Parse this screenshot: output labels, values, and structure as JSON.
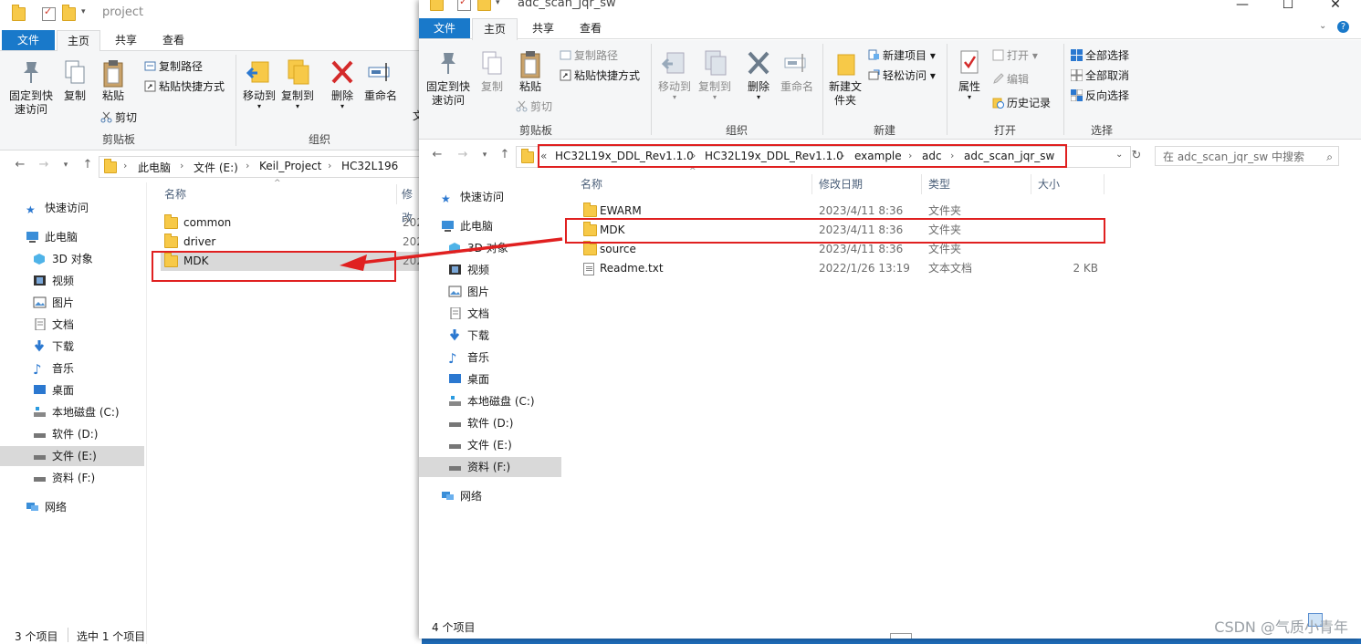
{
  "left": {
    "title": "project",
    "tabs": [
      "文件",
      "主页",
      "共享",
      "查看"
    ],
    "ribbon": {
      "pin": "固定到快速访问",
      "copy": "复制",
      "paste": "粘贴",
      "copy_path": "复制路径",
      "paste_shortcut": "粘贴快捷方式",
      "cut": "剪切",
      "clipboard": "剪贴板",
      "move_to": "移动到",
      "copy_to": "复制到",
      "delete": "删除",
      "rename": "重命名",
      "new_partial": "文",
      "organize": "组织"
    },
    "breadcrumb": [
      "此电脑",
      "文件 (E:)",
      "Keil_Project",
      "HC32L196"
    ],
    "col_name": "名称",
    "col_date": "修改",
    "nav": {
      "quick": "快速访问",
      "pc": "此电脑",
      "obj3d": "3D 对象",
      "video": "视频",
      "pictures": "图片",
      "docs": "文档",
      "downloads": "下载",
      "music": "音乐",
      "desktop": "桌面",
      "c": "本地磁盘 (C:)",
      "d": "软件 (D:)",
      "e": "文件 (E:)",
      "f": "资料 (F:)",
      "network": "网络"
    },
    "files": [
      {
        "name": "common",
        "date": "202"
      },
      {
        "name": "driver",
        "date": "202"
      },
      {
        "name": "MDK",
        "date": "202"
      }
    ],
    "status_count": "3 个项目",
    "status_selected": "选中 1 个项目"
  },
  "right": {
    "title": "adc_scan_jqr_sw",
    "tabs": [
      "文件",
      "主页",
      "共享",
      "查看"
    ],
    "ribbon": {
      "pin": "固定到快速访问",
      "copy": "复制",
      "paste": "粘贴",
      "copy_path": "复制路径",
      "paste_shortcut": "粘贴快捷方式",
      "cut": "剪切",
      "clipboard": "剪贴板",
      "move_to": "移动到",
      "copy_to": "复制到",
      "delete": "删除",
      "rename": "重命名",
      "organize": "组织",
      "new_item": "新建项目",
      "easy_access": "轻松访问",
      "new_folder": "新建文件夹",
      "new": "新建",
      "properties": "属性",
      "open": "打开",
      "edit": "编辑",
      "history": "历史记录",
      "open_group": "打开",
      "select_all": "全部选择",
      "select_none": "全部取消",
      "invert": "反向选择",
      "select_group": "选择"
    },
    "breadcrumb_prefix": "«",
    "breadcrumb": [
      "HC32L19x_DDL_Rev1.1.0",
      "HC32L19x_DDL_Rev1.1.0",
      "example",
      "adc",
      "adc_scan_jqr_sw"
    ],
    "search_placeholder": "在 adc_scan_jqr_sw 中搜索",
    "columns": {
      "name": "名称",
      "date": "修改日期",
      "type": "类型",
      "size": "大小"
    },
    "nav": {
      "quick": "快速访问",
      "pc": "此电脑",
      "obj3d": "3D 对象",
      "video": "视频",
      "pictures": "图片",
      "docs": "文档",
      "downloads": "下载",
      "music": "音乐",
      "desktop": "桌面",
      "c": "本地磁盘 (C:)",
      "d": "软件 (D:)",
      "e": "文件 (E:)",
      "f": "资料 (F:)",
      "network": "网络"
    },
    "files": [
      {
        "name": "EWARM",
        "date": "2023/4/11 8:36",
        "type": "文件夹",
        "size": ""
      },
      {
        "name": "MDK",
        "date": "2023/4/11 8:36",
        "type": "文件夹",
        "size": ""
      },
      {
        "name": "source",
        "date": "2023/4/11 8:36",
        "type": "文件夹",
        "size": ""
      },
      {
        "name": "Readme.txt",
        "date": "2022/1/26 13:19",
        "type": "文本文档",
        "size": "2 KB"
      }
    ],
    "status_count": "4 个项目"
  },
  "watermark": "CSDN @气质小青年",
  "colors": {
    "file_tab": "#1979ca",
    "annotation": "#e02020",
    "selection": "#cce8ff",
    "folder": "#f7c948"
  }
}
